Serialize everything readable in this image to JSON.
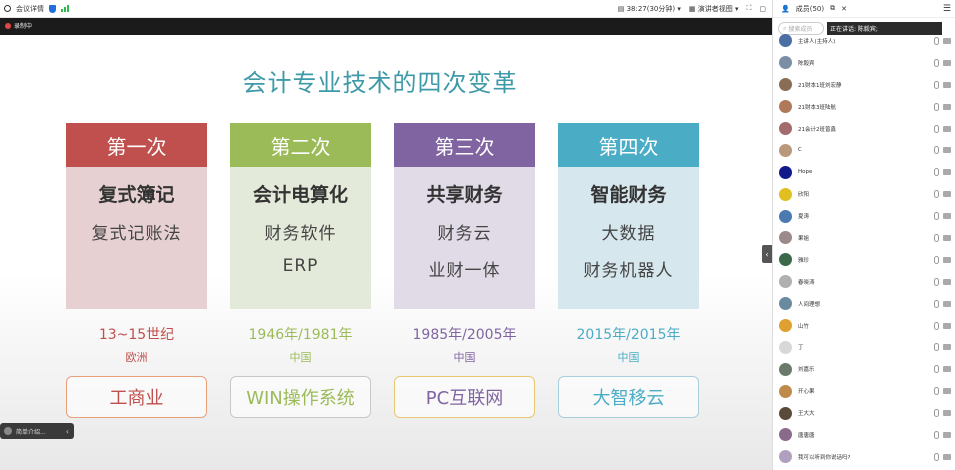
{
  "topbar": {
    "meeting_info": "会议详情",
    "time": "38:27(30分钟)",
    "view_mode": "演讲者视图"
  },
  "recording": {
    "label": "录制中"
  },
  "slide": {
    "title": "会计专业技术的四次变革",
    "cards": [
      {
        "head": "第一次",
        "keyword": "复式簿记",
        "lines": [
          "复式记账法"
        ],
        "years": "13~15世纪",
        "region": "欧洲",
        "domain": "工商业",
        "color": "#c0504d",
        "bg": "#e7d0d1"
      },
      {
        "head": "第二次",
        "keyword": "会计电算化",
        "lines": [
          "财务软件",
          "ERP"
        ],
        "years": "1946年/1981年",
        "region": "中国",
        "domain": "WIN操作系统",
        "color": "#9bbb59",
        "bg": "#e4ead9"
      },
      {
        "head": "第三次",
        "keyword": "共享财务",
        "lines": [
          "财务云",
          "业财一体"
        ],
        "years": "1985年/2005年",
        "region": "中国",
        "domain": "PC互联网",
        "color": "#8064a2",
        "bg": "#e1dbe7"
      },
      {
        "head": "第四次",
        "keyword": "智能财务",
        "lines": [
          "大数据",
          "财务机器人"
        ],
        "years": "2015年/2015年",
        "region": "中国",
        "domain": "大智移云",
        "color": "#4bacc6",
        "bg": "#d6e7ed"
      }
    ],
    "note_button": "简单介绍..."
  },
  "panel": {
    "title": "成员(50)",
    "search_placeholder": "搜索成员",
    "speaking_label": "正在讲话: 陈毅宾;",
    "members": [
      {
        "name": "主讲人(主持人)",
        "color": "#4a6fa5"
      },
      {
        "name": "陈毅宾",
        "color": "#7a8ea6"
      },
      {
        "name": "21财本1班刘宏静",
        "color": "#8a6d55"
      },
      {
        "name": "21财本3班陆航",
        "color": "#b07a5a"
      },
      {
        "name": "21会计2班曾鑫",
        "color": "#a36b6b"
      },
      {
        "name": "C",
        "color": "#b89a7a"
      },
      {
        "name": "Hope",
        "color": "#111a8a"
      },
      {
        "name": "欣阳",
        "color": "#e0c020"
      },
      {
        "name": "夏涛",
        "color": "#4a7ab0"
      },
      {
        "name": "果姐",
        "color": "#9a8a8a"
      },
      {
        "name": "雅珍",
        "color": "#3a6a4a"
      },
      {
        "name": "春晓涛",
        "color": "#b0b0b0"
      },
      {
        "name": "人间理想",
        "color": "#6a8aa0"
      },
      {
        "name": "山竹",
        "color": "#e0a030"
      },
      {
        "name": "丁",
        "color": "#d8d8d8"
      },
      {
        "name": "刘嘉乐",
        "color": "#6a7a6a"
      },
      {
        "name": "开心果",
        "color": "#c08a4a"
      },
      {
        "name": "王大大",
        "color": "#5a4a3a"
      },
      {
        "name": "唐唐唐",
        "color": "#8a6a8a"
      },
      {
        "name": "我可以听到你说话吗?",
        "color": "#b0a0c0"
      }
    ]
  }
}
